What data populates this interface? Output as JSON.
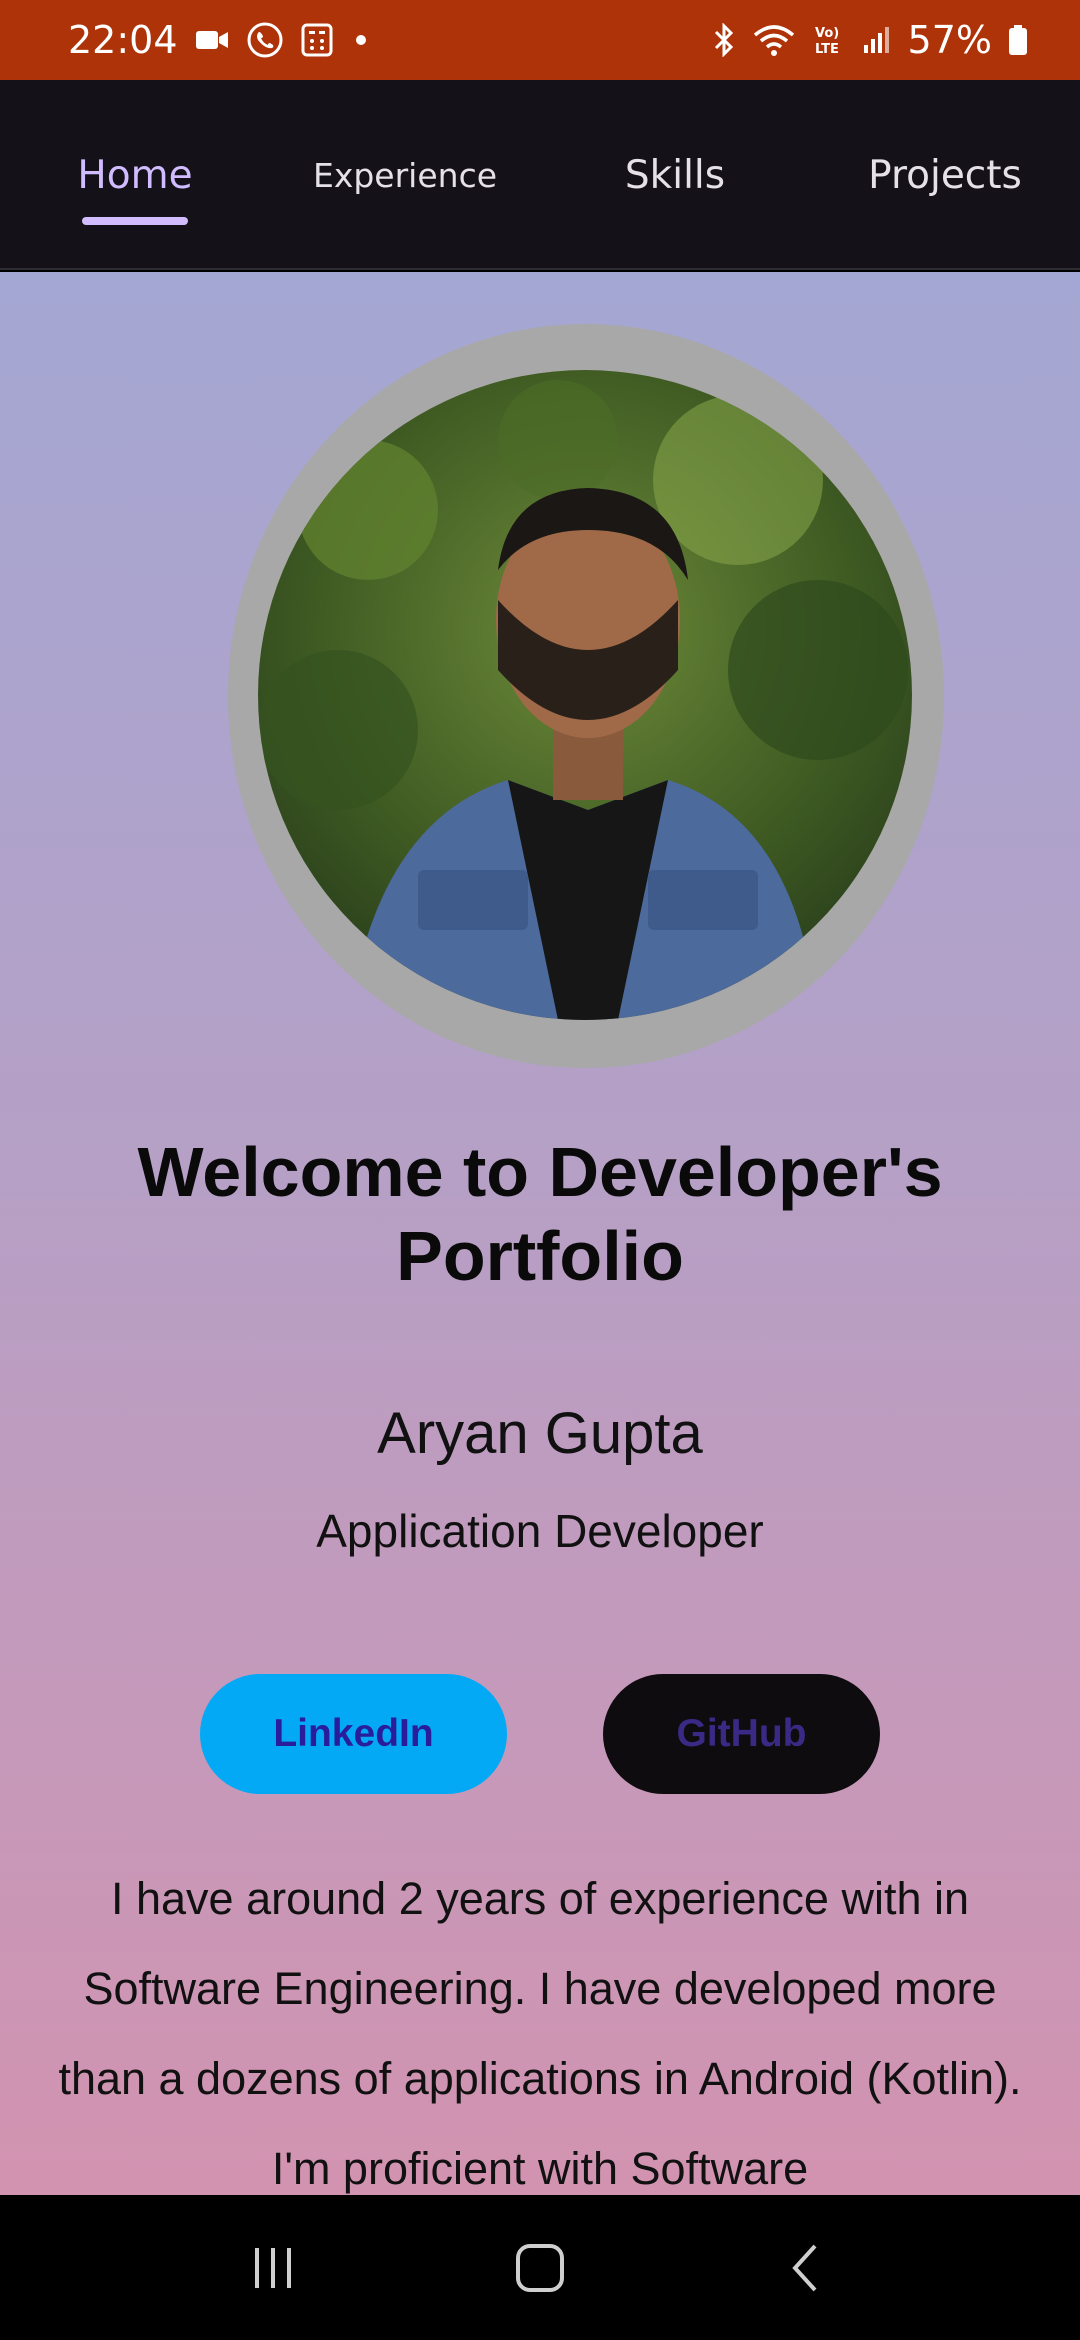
{
  "status_bar": {
    "time": "22:04",
    "battery": "57%",
    "icons_left": [
      "video-call-icon",
      "whatsapp-call-icon",
      "calculator-icon",
      "notification-dot"
    ],
    "icons_right": [
      "bluetooth-icon",
      "wifi-icon",
      "volte-icon",
      "signal-icon",
      "battery-icon"
    ]
  },
  "tabs": [
    {
      "label": "Home",
      "active": true
    },
    {
      "label": "Experience",
      "active": false
    },
    {
      "label": "Skills",
      "active": false
    },
    {
      "label": "Projects",
      "active": false
    }
  ],
  "home": {
    "title": "Welcome to Developer's Portfolio",
    "name": "Aryan Gupta",
    "role": "Application Developer",
    "linkedin_label": "LinkedIn",
    "github_label": "GitHub",
    "bio": "I have around 2 years of experience with in Software Engineering. I have developed more than a dozens of applications in Android (Kotlin). I'm proficient with Software"
  },
  "nav_bar": {
    "icons": [
      "recent-apps-icon",
      "home-icon",
      "back-icon"
    ]
  },
  "colors": {
    "status_bar": "#ae3308",
    "tab_bar": "#141218",
    "tab_active": "#d0bcff",
    "linkedin_button": "#03a9f4",
    "github_button": "#0e0c0e"
  }
}
